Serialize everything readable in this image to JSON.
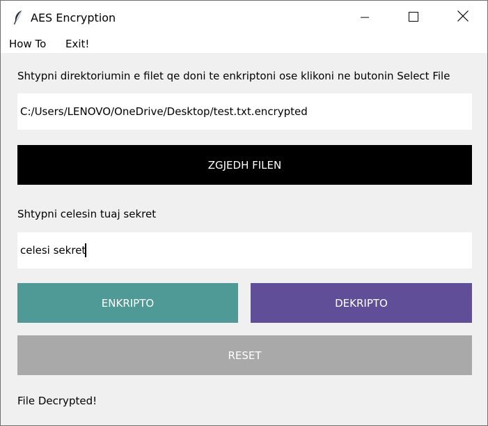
{
  "window": {
    "title": "AES Encryption",
    "app_icon": "feather-icon",
    "controls": [
      "minimize-icon",
      "maximize-icon",
      "close-icon"
    ]
  },
  "menu": {
    "items": [
      {
        "label": "How To"
      },
      {
        "label": "Exit!"
      }
    ]
  },
  "main": {
    "instructions": "Shtypni direktoriumin e filet qe doni te enkriptoni ose klikoni ne butonin Select File",
    "file_path": "C:/Users/LENOVO/OneDrive/Desktop/test.txt.encrypted",
    "select_button": "ZGJEDH FILEN",
    "key_label": "Shtypni celesin tuaj sekret",
    "key_value": "celesi sekret",
    "encrypt_button": "ENKRIPTO",
    "decrypt_button": "DEKRIPTO",
    "reset_button": "RESET",
    "status": "File Decrypted!"
  },
  "colors": {
    "select_button_bg": "#000000",
    "encrypt_button_bg": "#4f9a96",
    "decrypt_button_bg": "#604f98",
    "reset_button_bg": "#a9a9a9",
    "window_bg": "#f0f0f0"
  }
}
